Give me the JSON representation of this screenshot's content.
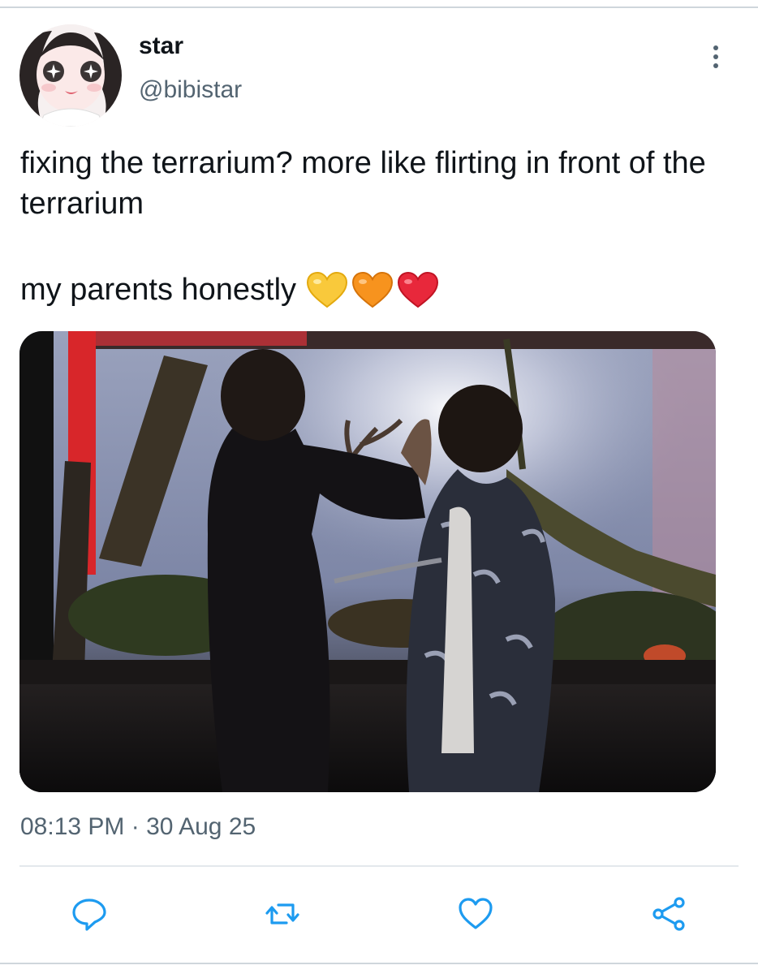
{
  "tweet": {
    "display_name": "star",
    "handle": "@bibistar",
    "text_line1": "fixing the terrarium? more like flirting in front of the terrarium",
    "text_line2": "my parents honestly",
    "emojis": [
      "yellow-heart",
      "orange-heart",
      "red-heart"
    ],
    "timestamp": "08:13 PM · 30 Aug 25"
  },
  "actions": [
    "reply-icon",
    "retweet-icon",
    "like-icon",
    "share-icon"
  ],
  "colors": {
    "text_primary": "#0f1419",
    "text_secondary": "#536471",
    "yellow_heart": "#f9c93b",
    "orange_heart": "#f7931e",
    "red_heart": "#e8283b"
  }
}
